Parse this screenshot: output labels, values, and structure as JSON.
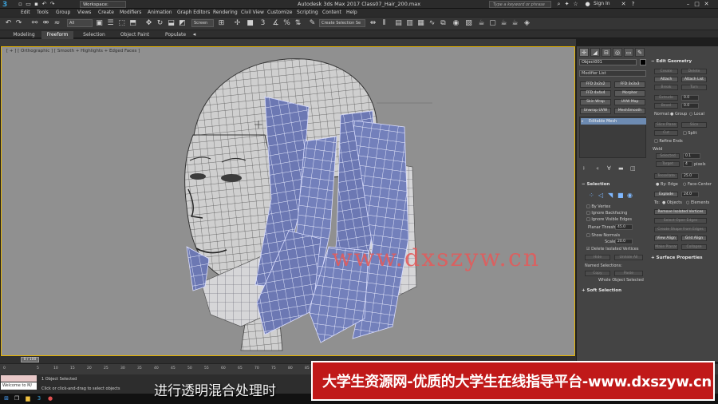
{
  "app": {
    "title": "Autodesk 3ds Max 2017     Class07_Hair_200.max",
    "workspace": "Workspace: Default",
    "search_placeholder": "Type a keyword or phrase",
    "sign_in": "Sign In"
  },
  "menu": [
    "Edit",
    "Tools",
    "Group",
    "Views",
    "Create",
    "Modifiers",
    "Animation",
    "Graph Editors",
    "Rendering",
    "Civil View",
    "Customize",
    "Scripting",
    "Content",
    "Help"
  ],
  "toolbar": {
    "filter": "All",
    "view": "Screen",
    "selection_set": "Create Selection Se"
  },
  "ribbon": [
    "Modeling",
    "Freeform",
    "Selection",
    "Object Paint",
    "Populate"
  ],
  "viewport": {
    "label": "[ + ] [ Orthographic ] [ Smooth + Highlights + Edged Faces ]",
    "watermark": "www.dxszyw.cn"
  },
  "command_panel": {
    "object_name": "Object001",
    "modifier_list": "Modifier List",
    "modifier_buttons": [
      "FFD 2x2x2",
      "FFD 3x3x3",
      "FFD 4x4x4",
      "Morpher",
      "Skin Wrap",
      "UVW Map",
      "Unwrap UVW",
      "MeshSmooth"
    ],
    "stack_item": "Editable Mesh",
    "selection": {
      "title": "Selection",
      "by_vertex": "By Vertex",
      "ignore_backfacing": "Ignore Backfacing",
      "ignore_visible_edges": "Ignore Visible Edges",
      "planar_thresh": "Planar Thresh:",
      "planar_value": "45.0",
      "show_normals": "Show Normals",
      "scale": "Scale:",
      "scale_value": "20.0",
      "delete_isolated": "Delete Isolated Vertices",
      "hide": "Hide",
      "unhide_all": "Unhide All",
      "named_selections": "Named Selections:",
      "copy": "Copy",
      "paste": "Paste",
      "whole_object": "Whole Object Selected"
    },
    "soft_selection": "Soft Selection",
    "edit_geometry": {
      "title": "Edit Geometry",
      "create": "Create",
      "delete": "Delete",
      "attach": "Attach",
      "attach_list": "Attach List",
      "break": "Break",
      "turn": "Turn",
      "extrude": "Extrude",
      "extrude_value": "0.0",
      "bevel": "Bevel",
      "bevel_value": "0.0",
      "normal": "Normal:",
      "group": "Group",
      "local": "Local",
      "slice_plane": "Slice Plane",
      "slice": "Slice",
      "cut": "Cut",
      "split": "Split",
      "refine_ends": "Refine Ends",
      "weld": "Weld",
      "selected": "Selected",
      "selected_value": "0.1",
      "target": "Target",
      "target_value": "4",
      "pixels": "pixels",
      "tessellate": "Tessellate",
      "tessellate_value": "25.0",
      "by_edge": "By: Edge",
      "face_center": "Face-Center",
      "explode": "Explode",
      "explode_value": "24.0",
      "to_objects": "Objects",
      "to_elements": "Elements",
      "to_label": "To:",
      "remove_isolated": "Remove Isolated Vertices",
      "select_open_edges": "Select Open Edges",
      "create_shape": "Create Shape from Edges",
      "view_align": "View Align",
      "grid_align": "Grid Align",
      "make_planar": "Make Planar",
      "collapse": "Collapse"
    },
    "surface_properties": "Surface Properties"
  },
  "timeline": {
    "frame": "0 / 100",
    "ticks": [
      "0",
      "5",
      "10",
      "15",
      "20",
      "25",
      "30",
      "35",
      "40",
      "45",
      "50",
      "55",
      "60",
      "65",
      "70",
      "75",
      "80",
      "85"
    ]
  },
  "status": {
    "welcome": "Welcome to M/",
    "selected": "1 Object Selected",
    "prompt": "Click or click-and-drag to select objects"
  },
  "subtitle": "进行透明混合处理时",
  "banner": "大学生资源网-优质的大学生在线指导平台-www.dxszyw.cn"
}
